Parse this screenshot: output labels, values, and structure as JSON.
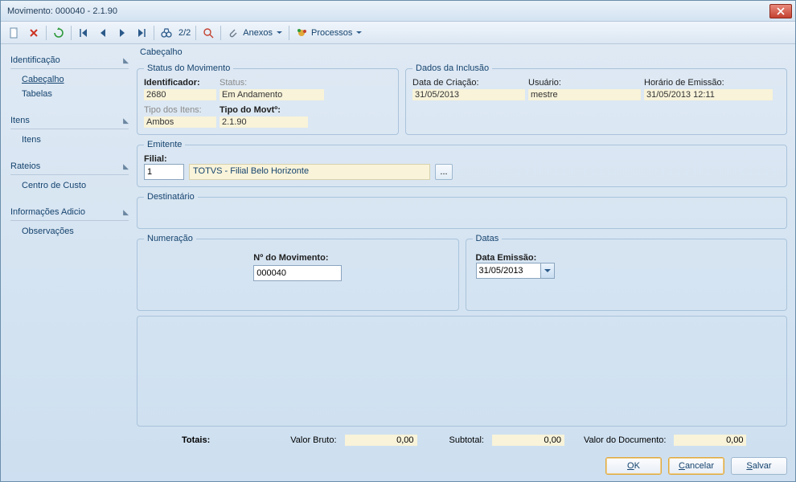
{
  "window": {
    "title": "Movimento: 000040 - 2.1.90"
  },
  "toolbar": {
    "record_position": "2/2",
    "anexos_label": "Anexos",
    "processos_label": "Processos"
  },
  "sidebar": {
    "sections": [
      {
        "title": "Identificação",
        "items": [
          {
            "label": "Cabeçalho",
            "active": true
          },
          {
            "label": "Tabelas",
            "active": false
          }
        ]
      },
      {
        "title": "Itens",
        "items": [
          {
            "label": "Itens",
            "active": false
          }
        ]
      },
      {
        "title": "Rateios",
        "items": [
          {
            "label": "Centro de Custo",
            "active": false
          }
        ]
      },
      {
        "title": "Informações Adicio",
        "items": [
          {
            "label": "Observações",
            "active": false
          }
        ]
      }
    ]
  },
  "tab_label": "Cabeçalho",
  "status_movimento": {
    "legend": "Status do Movimento",
    "identificador_label": "Identificador:",
    "identificador_value": "2680",
    "status_label": "Status:",
    "status_value": "Em Andamento",
    "tipo_itens_label": "Tipo dos Itens:",
    "tipo_itens_value": "Ambos",
    "tipo_movto_label": "Tipo do Movtº:",
    "tipo_movto_value": "2.1.90"
  },
  "dados_inclusao": {
    "legend": "Dados da Inclusão",
    "data_criacao_label": "Data de Criação:",
    "data_criacao_value": "31/05/2013",
    "usuario_label": "Usuário:",
    "usuario_value": "mestre",
    "horario_emissao_label": "Horário de Emissão:",
    "horario_emissao_value": "31/05/2013 12:11"
  },
  "emitente": {
    "legend": "Emitente",
    "filial_label": "Filial:",
    "filial_code": "1",
    "filial_name": "TOTVS - Filial Belo Horizonte"
  },
  "destinatario": {
    "legend": "Destinatário"
  },
  "numeracao": {
    "legend": "Numeração",
    "num_movimento_label": "Nº do Movimento:",
    "num_movimento_value": "000040"
  },
  "datas": {
    "legend": "Datas",
    "data_emissao_label": "Data Emissão:",
    "data_emissao_value": "31/05/2013"
  },
  "totals": {
    "label": "Totais:",
    "valor_bruto_label": "Valor Bruto:",
    "valor_bruto_value": "0,00",
    "subtotal_label": "Subtotal:",
    "subtotal_value": "0,00",
    "valor_documento_label": "Valor do Documento:",
    "valor_documento_value": "0,00"
  },
  "buttons": {
    "ok": "OK",
    "cancelar": "Cancelar",
    "salvar": "Salvar"
  }
}
